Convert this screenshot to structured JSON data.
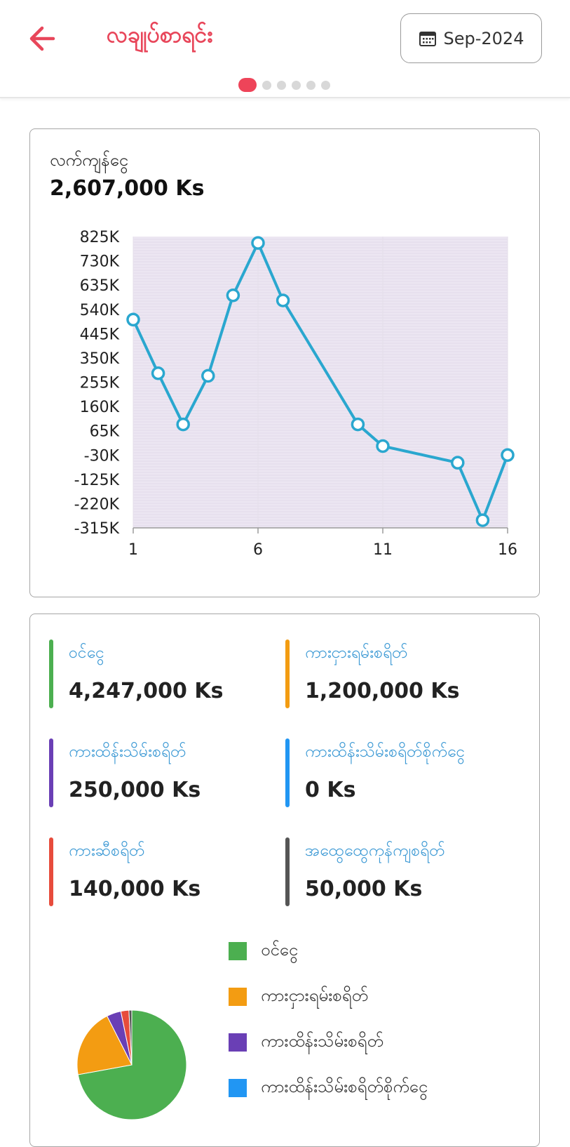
{
  "header": {
    "title": "လချုပ်စာရင်း",
    "month": "Sep-2024",
    "page_count": 6,
    "active_page": 0
  },
  "balance": {
    "label": "လက်ကျန်ငွေ",
    "value": "2,607,000 Ks"
  },
  "chart_data": {
    "type": "line",
    "x": [
      1,
      2,
      3,
      4,
      5,
      6,
      7,
      10,
      11,
      14,
      15,
      16
    ],
    "y": [
      500000,
      290000,
      90000,
      280000,
      595000,
      800000,
      575000,
      90000,
      5000,
      -60000,
      -285000,
      -30000
    ],
    "xticks": [
      "1",
      "6",
      "11",
      "16"
    ],
    "yticks": [
      "825K",
      "730K",
      "635K",
      "540K",
      "445K",
      "350K",
      "255K",
      "160K",
      "65K",
      "-30K",
      "-125K",
      "-220K",
      "-315K"
    ],
    "xlim": [
      1,
      16
    ],
    "ylim": [
      -315000,
      825000
    ],
    "line_color": "#2aa7cf",
    "plot_bg": "#ece6f2"
  },
  "stats": [
    {
      "label": "ဝင်ငွေ",
      "value": "4,247,000 Ks",
      "color": "#4caf50"
    },
    {
      "label": "ကားငှားရမ်းစရိတ်",
      "value": "1,200,000 Ks",
      "color": "#f39c12"
    },
    {
      "label": "ကားထိန်းသိမ်းစရိတ်",
      "value": "250,000 Ks",
      "color": "#6a3fb5"
    },
    {
      "label": "ကားထိန်းသိမ်းစရိတ်စိုက်ငွေ",
      "value": "0 Ks",
      "color": "#2196f3"
    },
    {
      "label": "ကားဆီစရိတ်",
      "value": "140,000 Ks",
      "color": "#e74c3c"
    },
    {
      "label": "အထွေထွေကုန်ကျစရိတ်",
      "value": "50,000 Ks",
      "color": "#555555"
    }
  ],
  "pie": {
    "values": [
      4247000,
      1200000,
      250000,
      0,
      140000,
      50000
    ],
    "legend": [
      "ဝင်ငွေ",
      "ကားငှားရမ်းစရိတ်",
      "ကားထိန်းသိမ်းစရိတ်",
      "ကားထိန်းသိမ်းစရိတ်စိုက်ငွေ"
    ]
  },
  "icons": {
    "back": "arrow-left-icon",
    "calendar": "calendar-icon"
  },
  "colors": {
    "accent": "#e8465a"
  }
}
